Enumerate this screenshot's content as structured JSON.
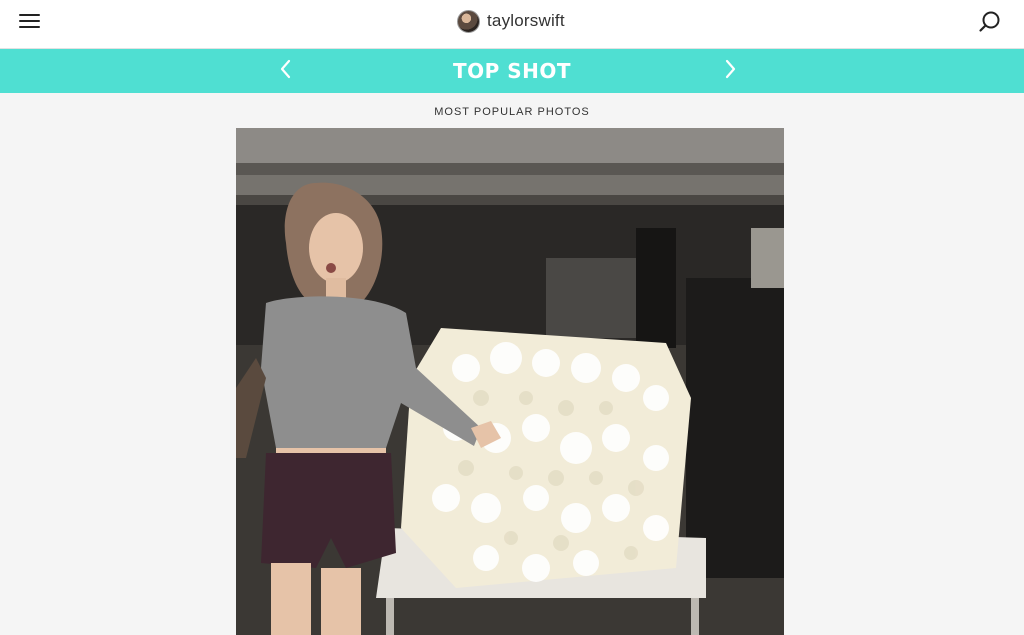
{
  "header": {
    "brand_name": "taylorswift",
    "menu_icon": "hamburger-menu-icon",
    "search_icon": "search-icon"
  },
  "banner": {
    "title": "TOP SHOT",
    "prev_icon": "chevron-left-icon",
    "next_icon": "chevron-right-icon",
    "color": "#4fdfd2"
  },
  "main": {
    "subheading": "MOST POPULAR PHOTOS"
  }
}
